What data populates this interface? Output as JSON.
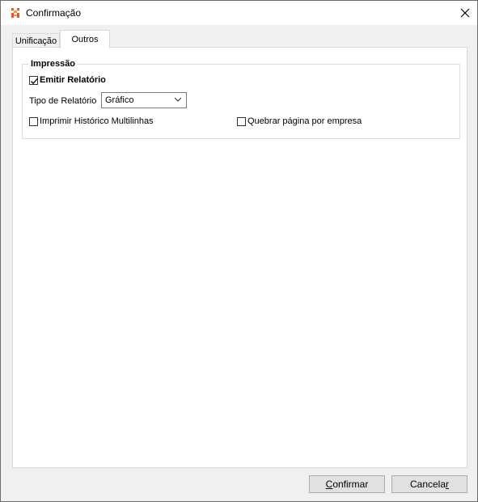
{
  "window": {
    "title": "Confirmação",
    "close_icon": "close-icon",
    "app_icon": "app-logo-icon"
  },
  "tabs": [
    {
      "label": "Unificação",
      "active": false
    },
    {
      "label": "Outros",
      "active": true
    }
  ],
  "impressao": {
    "title": "Impressão",
    "emitir_relatorio": {
      "label": "Emitir Relatório",
      "checked": true
    },
    "tipo_relatorio": {
      "label": "Tipo de Relatório",
      "value": "Gráfico"
    },
    "imprimir_historico": {
      "label": "Imprimir Histórico Multilinhas",
      "checked": false
    },
    "quebrar_pagina": {
      "label": "Quebrar página por empresa",
      "checked": false
    }
  },
  "buttons": {
    "confirmar": {
      "accel": "C",
      "rest": "onfirmar"
    },
    "cancelar": {
      "rest": "Cancela",
      "accel": "r"
    }
  },
  "colors": {
    "accent_icon": "#e8562a",
    "window_bg": "#f0f0f0",
    "panel_bg": "#ffffff"
  }
}
